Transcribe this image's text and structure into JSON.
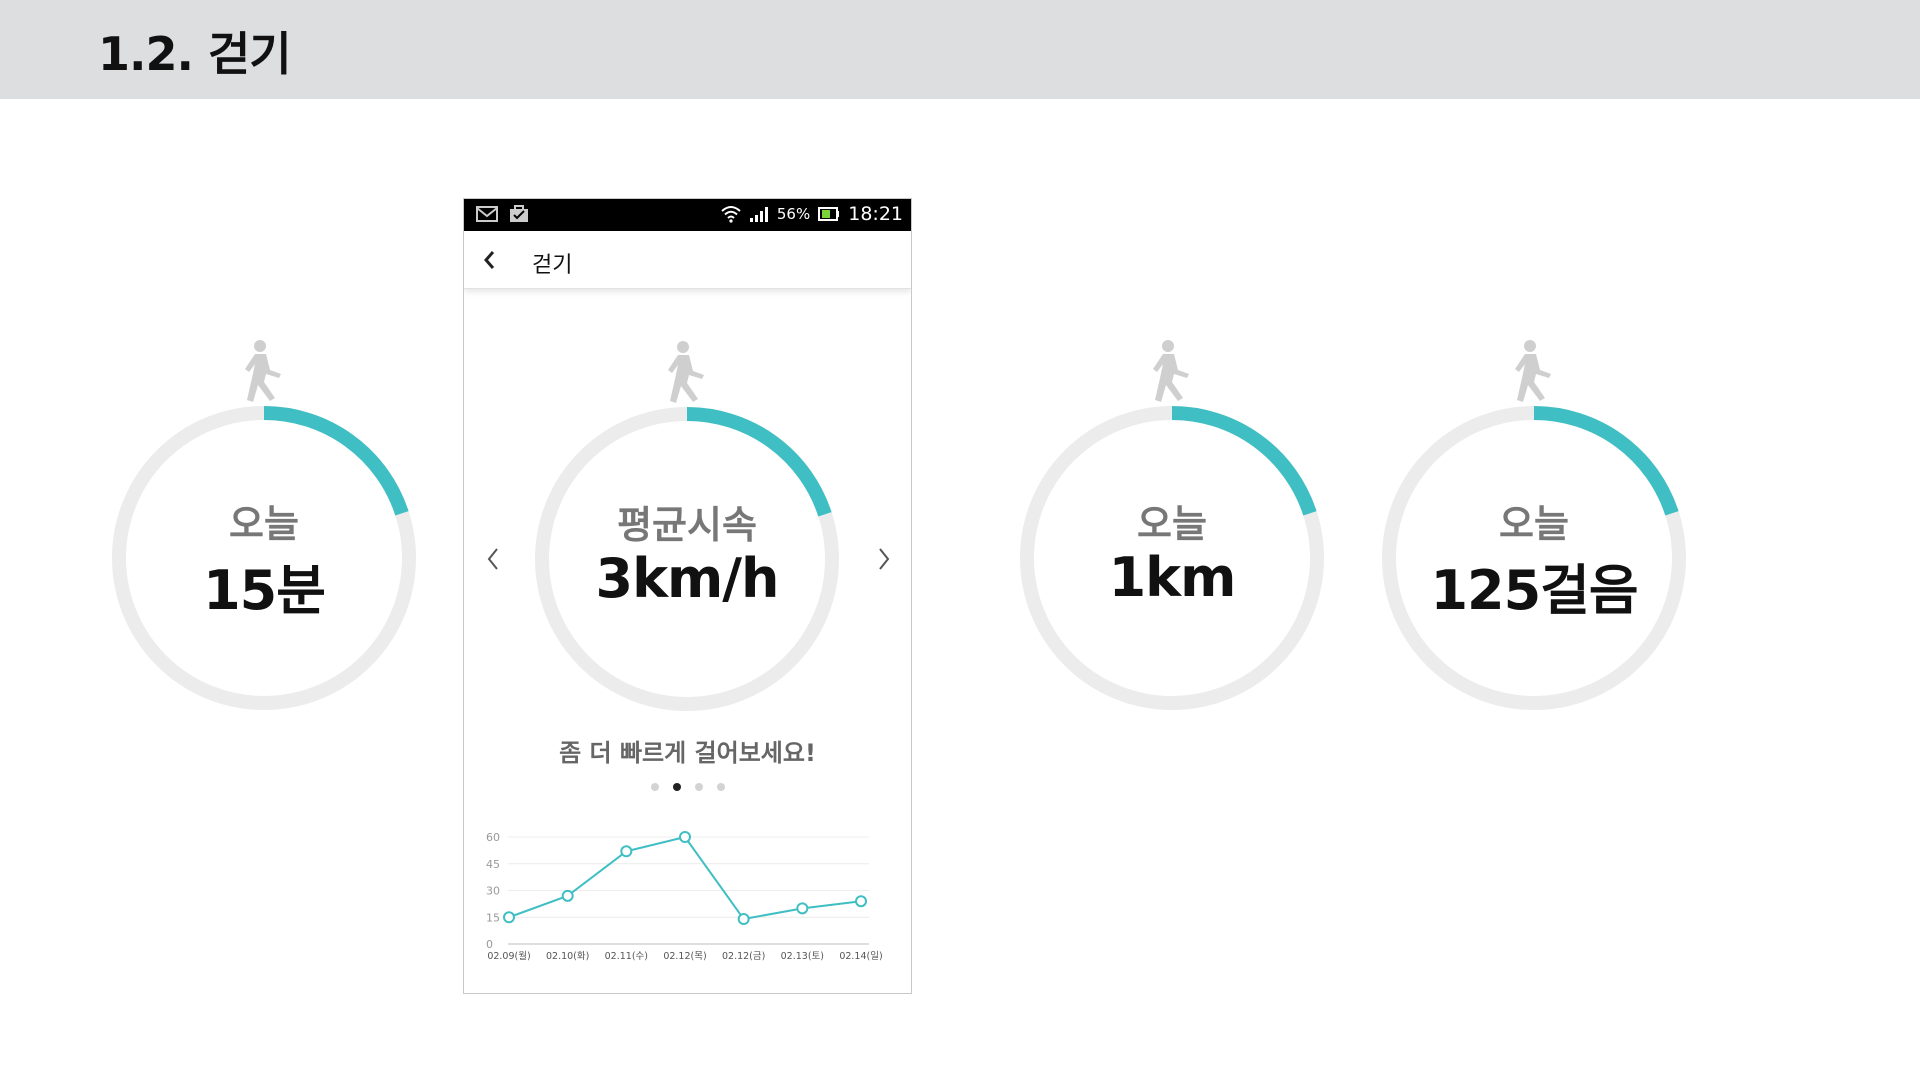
{
  "page": {
    "title": "1.2. 걷기"
  },
  "colors": {
    "accent": "#3fbfc4",
    "track": "#ececec",
    "header_bg": "#dddee0"
  },
  "progress_fraction": 0.2,
  "cards": [
    {
      "label": "오늘",
      "value": "15분"
    },
    {
      "label": "오늘",
      "value": "1km"
    },
    {
      "label": "오늘",
      "value": "125걸음"
    }
  ],
  "phone": {
    "status": {
      "battery": "56%",
      "time": "18:21",
      "icons": [
        "mail-icon",
        "briefcase-icon",
        "wifi-icon",
        "signal-icon",
        "battery-icon"
      ]
    },
    "app_bar": {
      "back_icon": "chevron-left-icon",
      "title": "걷기"
    },
    "metric": {
      "label": "평균시속",
      "value": "3km/h"
    },
    "tip": "좀 더 빠르게 걸어보세요!",
    "pager": {
      "count": 4,
      "active": 1
    }
  },
  "chart_data": {
    "type": "line",
    "categories": [
      "02.09(월)",
      "02.10(화)",
      "02.11(수)",
      "02.12(목)",
      "02.12(금)",
      "02.13(토)",
      "02.14(일)"
    ],
    "values": [
      15,
      27,
      52,
      60,
      14,
      20,
      24
    ],
    "yticks": [
      0,
      15,
      30,
      45,
      60
    ],
    "ylim": [
      0,
      60
    ],
    "grid": true
  }
}
